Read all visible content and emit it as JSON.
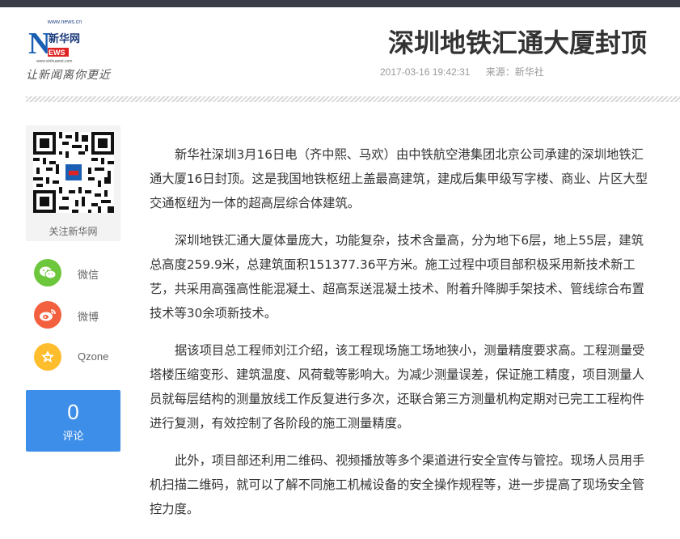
{
  "header": {
    "logo_url_text": "www.news.cn",
    "logo_brand": "新华网",
    "logo_url_small": "www.xinhuanet.com",
    "slogan": "让新闻离你更近",
    "title": "深圳地铁汇通大厦封顶",
    "datetime": "2017-03-16 19:42:31",
    "source": "来源：新华社"
  },
  "sidebar": {
    "qr_label": "关注新华网",
    "share": [
      {
        "label": "微信",
        "icon": "wechat-icon",
        "color": "#6dc73c"
      },
      {
        "label": "微博",
        "icon": "weibo-icon",
        "color": "#f3603f"
      },
      {
        "label": "Qzone",
        "icon": "qzone-icon",
        "color": "#fdbd2c"
      }
    ],
    "comment": {
      "count": "0",
      "label": "评论",
      "color": "#3d8ee8"
    }
  },
  "article": {
    "paragraphs": [
      "新华社深圳3月16日电（齐中熙、马欢）由中铁航空港集团北京公司承建的深圳地铁汇通大厦16日封顶。这是我国地铁枢纽上盖最高建筑，建成后集甲级写字楼、商业、片区大型交通枢纽为一体的超高层综合体建筑。",
      "深圳地铁汇通大厦体量庞大，功能复杂，技术含量高，分为地下6层，地上55层，建筑总高度259.9米，总建筑面积151377.36平方米。施工过程中项目部积极采用新技术新工艺，共采用高强高性能混凝土、超高泵送混凝土技术、附着升降脚手架技术、管线综合布置技术等30余项新技术。",
      "据该项目总工程师刘江介绍，该工程现场施工场地狭小，测量精度要求高。工程测量受塔楼压缩变形、建筑温度、风荷载等影响大。为减少测量误差，保证施工精度，项目测量人员就每层结构的测量放线工作反复进行多次，还联合第三方测量机构定期对已完工工程构件进行复测，有效控制了各阶段的施工测量精度。",
      "此外，项目部还利用二维码、视频播放等多个渠道进行安全宣传与管控。现场人员用手机扫描二维码，就可以了解不同施工机械设备的安全操作规程等，进一步提高了现场安全管控力度。"
    ]
  }
}
